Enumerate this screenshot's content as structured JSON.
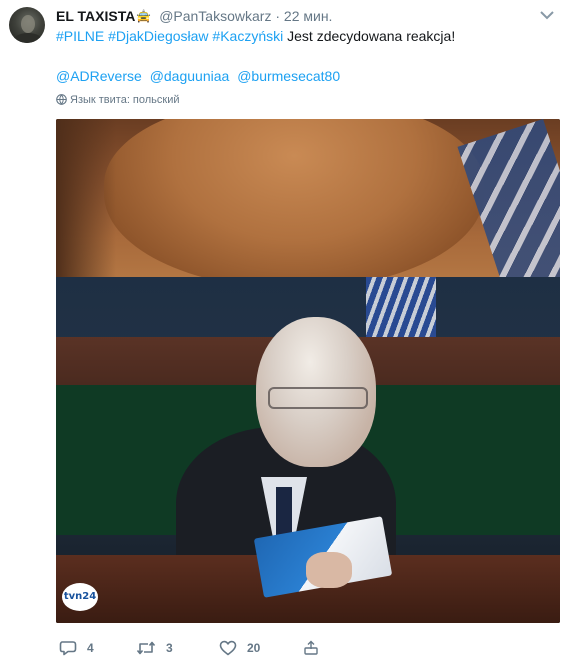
{
  "tweet": {
    "author_name": "EL TAXISTA",
    "author_emoji": "🚖",
    "handle": "@PanTaksowkarz",
    "separator": "·",
    "time": "22 мин.",
    "text_hashtags": [
      "#PILNE",
      "#DjakDiegosław",
      "#Kaczyński"
    ],
    "text_rest": "Jest zdecydowana reakcja!",
    "mentions": [
      "@ADReverse",
      "@daguuniaa",
      "@burmesecat80"
    ],
    "language_label": "Язык твита: польский"
  },
  "media": {
    "tv_logo_text": "tvn24"
  },
  "actions": {
    "replies": "4",
    "retweets": "3",
    "likes": "20"
  },
  "icons": {
    "caret": "chevron-down-icon",
    "globe": "globe-icon",
    "reply": "reply-icon",
    "retweet": "retweet-icon",
    "like": "heart-icon",
    "more": "more-icon"
  },
  "colors": {
    "link": "#1da1f2",
    "muted": "#657786",
    "text": "#14171a"
  }
}
